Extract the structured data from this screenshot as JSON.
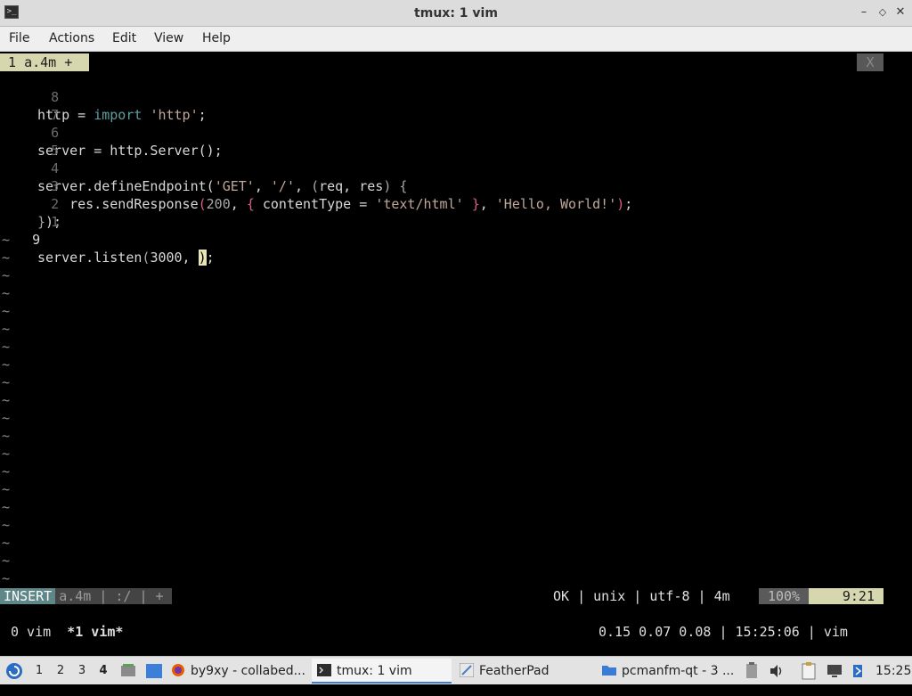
{
  "window": {
    "title": "tmux: 1 vim",
    "minimize_glyph": "–",
    "maximize_glyph": "◇",
    "close_glyph": "✕"
  },
  "menu": [
    "File",
    "Actions",
    "Edit",
    "View",
    "Help"
  ],
  "vim": {
    "tabline": {
      "label": "1 a.4m +",
      "close": "X"
    },
    "lines": [
      {
        "num": "8",
        "text": "http = import 'http';"
      },
      {
        "num": "7",
        "text": ""
      },
      {
        "num": "6",
        "text": "server = http.Server();"
      },
      {
        "num": "5",
        "text": ""
      },
      {
        "num": "4",
        "text": "server.defineEndpoint('GET', '/', (req, res) {"
      },
      {
        "num": "3",
        "text": "    res.sendResponse(200, { contentType = 'text/html' }, 'Hello, World!');"
      },
      {
        "num": "2",
        "text": "});"
      },
      {
        "num": "1",
        "text": ""
      },
      {
        "num": "9",
        "text": "server.listen(3000, );"
      }
    ],
    "tilde": "~",
    "statusline": {
      "mode": "INSERT",
      "info": "a.4m | :/ | +",
      "right": "OK | unix | utf-8 | 4m",
      "percent": "100%",
      "position": "9:21"
    }
  },
  "tmux": {
    "windows_left": "0 vim  *1 vim*",
    "status_right": "0.15 0.07 0.08 | 15:25:06 | vim"
  },
  "taskbar": {
    "desktops": [
      "1",
      "2",
      "3",
      "4"
    ],
    "active_desktop": "4",
    "tasks": [
      {
        "label": "by9xy - collabed...",
        "icon": "firefox-icon"
      },
      {
        "label": "tmux: 1 vim",
        "icon": "terminal-icon"
      },
      {
        "label": "FeatherPad",
        "icon": "featherpad-icon"
      },
      {
        "label": "pcmanfm-qt - 3 ...",
        "icon": "folder-icon"
      }
    ],
    "clock": "15:25"
  },
  "colors": {
    "accent": "#3a7bd5",
    "mode_bg": "#5f8787",
    "position_bg": "#d7d7af",
    "cursor": "#e8e4b6"
  }
}
